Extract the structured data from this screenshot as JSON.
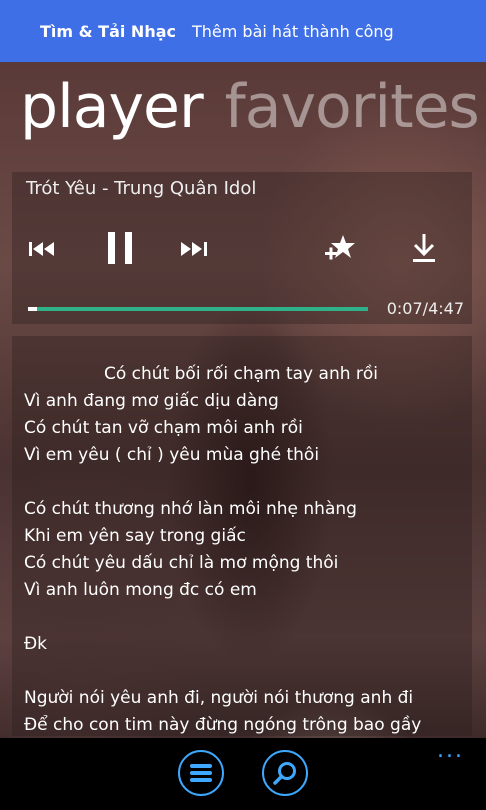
{
  "status_bar": {
    "app_name": "Tìm & Tải Nhạc",
    "message": "Thêm bài hát thành công"
  },
  "pivot": {
    "active": "player",
    "inactive": "favorites"
  },
  "player": {
    "song_title": "Trót Yêu - Trung Quân Idol",
    "elapsed": "0:07",
    "duration": "/4:47",
    "progress_fraction": 0.025,
    "accent_color": "#2fb28a",
    "icons": [
      "previous-icon",
      "pause-icon",
      "next-icon",
      "favorite-add-icon",
      "download-icon"
    ]
  },
  "lyrics": {
    "lines": [
      "Có chút bối rối chạm tay anh rồi",
      "Vì anh đang mơ giấc dịu dàng",
      "Có chút tan vỡ chạm môi anh rồi",
      "Vì em yêu ( chỉ ) yêu mùa ghé thôi",
      "",
      "Có chút thương nhớ làn môi nhẹ nhàng",
      "Khi em yên say trong giấc",
      "Có chút yêu dấu chỉ là mơ mộng thôi",
      "Vì anh luôn mong đc có em",
      "",
      "Đk",
      "",
      "Người nói yêu anh đi, người nói thương anh đi",
      "Để cho con tim này đừng ngóng trông bao gầy"
    ]
  },
  "app_bar": {
    "more_label": "...",
    "accent_color": "#3ea8ff",
    "icons": [
      "menu-icon",
      "search-icon"
    ]
  }
}
